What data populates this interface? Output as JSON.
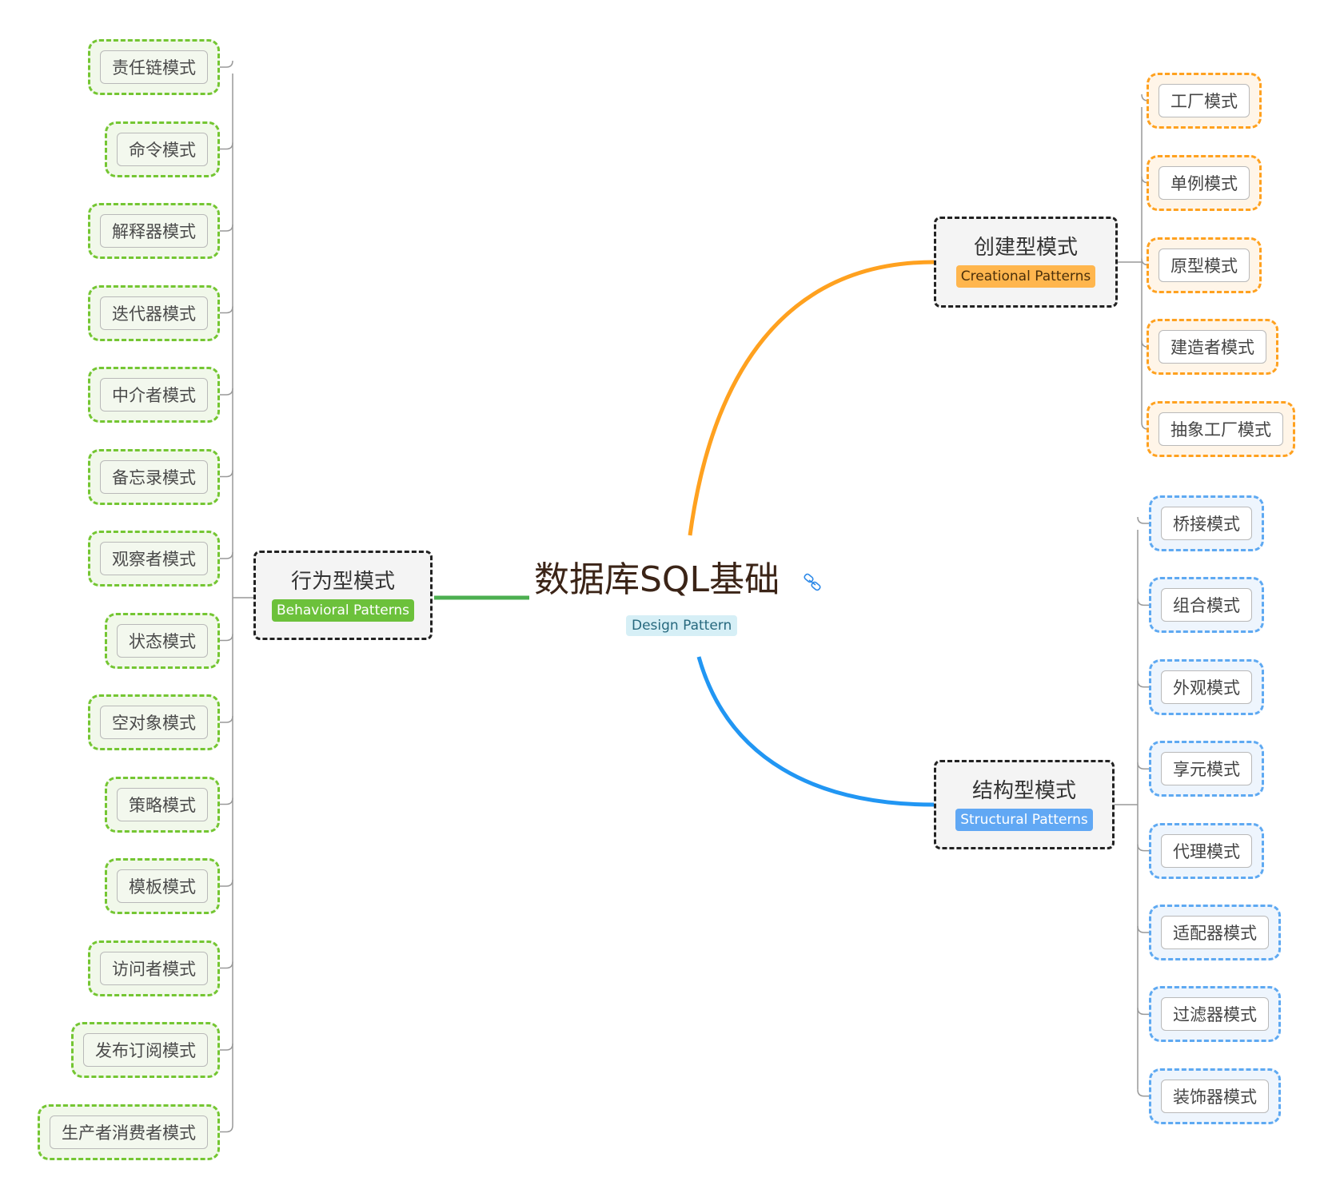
{
  "central": {
    "title": "数据库SQL基础",
    "tag": "Design Pattern",
    "icon": "link-icon"
  },
  "colors": {
    "creational": "#ffa11f",
    "structural": "#2196f3",
    "behavioral": "#4caf50",
    "connector": "#999999"
  },
  "branches": {
    "creational": {
      "title": "创建型模式",
      "subtitle": "Creational Patterns",
      "children": [
        "工厂模式",
        "单例模式",
        "原型模式",
        "建造者模式",
        "抽象工厂模式"
      ]
    },
    "structural": {
      "title": "结构型模式",
      "subtitle": "Structural Patterns",
      "children": [
        "桥接模式",
        "组合模式",
        "外观模式",
        "享元模式",
        "代理模式",
        "适配器模式",
        "过滤器模式",
        "装饰器模式"
      ]
    },
    "behavioral": {
      "title": "行为型模式",
      "subtitle": "Behavioral Patterns",
      "children": [
        "责任链模式",
        "命令模式",
        "解释器模式",
        "迭代器模式",
        "中介者模式",
        "备忘录模式",
        "观察者模式",
        "状态模式",
        "空对象模式",
        "策略模式",
        "模板模式",
        "访问者模式",
        "发布订阅模式",
        "生产者消费者模式"
      ]
    }
  }
}
